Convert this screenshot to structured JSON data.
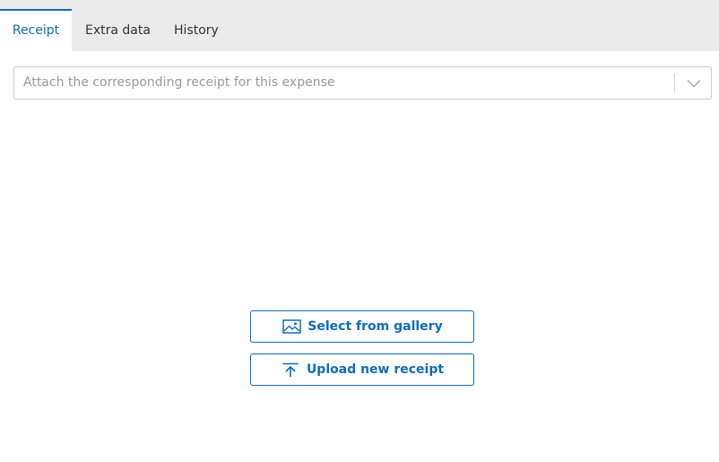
{
  "tabs": [
    {
      "label": "Receipt",
      "active": true
    },
    {
      "label": "Extra data",
      "active": false
    },
    {
      "label": "History",
      "active": false
    }
  ],
  "receipt_select": {
    "placeholder": "Attach the corresponding receipt for this expense",
    "toggle_icon": "chevron-down-icon"
  },
  "actions": {
    "gallery_label": "Select from gallery",
    "gallery_icon": "image-icon",
    "upload_label": "Upload new receipt",
    "upload_icon": "upload-icon"
  },
  "colors": {
    "accent": "#0f6cbd",
    "tabbar_bg": "#ebebec",
    "placeholder": "#9a9a9a"
  }
}
